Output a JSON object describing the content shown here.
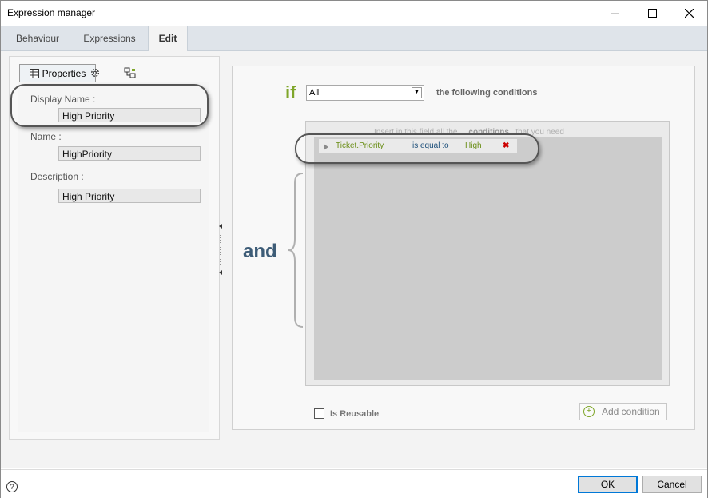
{
  "window": {
    "title": "Expression manager",
    "minimize": "—",
    "maximize": "☐",
    "close": "✕"
  },
  "tabs": [
    {
      "label": "Behaviour"
    },
    {
      "label": "Expressions"
    },
    {
      "label": "Edit"
    }
  ],
  "left_panel": {
    "subtabs": {
      "properties_label": "Properties"
    },
    "fields": {
      "display_name": {
        "label": "Display Name :",
        "value": "High Priority"
      },
      "name": {
        "label": "Name :",
        "value": "HighPriority"
      },
      "description": {
        "label": "Description :",
        "value": "High Priority"
      }
    }
  },
  "rule": {
    "if_label": "if",
    "quantifier": "All",
    "following_label": "the following conditions",
    "hint_prefix": "Insert in this field all the",
    "hint_bold": "conditions",
    "hint_suffix": "that you need",
    "conditions": [
      {
        "field": "Ticket.Priority",
        "operator": "is equal to",
        "value": "High"
      }
    ],
    "and_label": "and",
    "is_reusable_label": "Is Reusable",
    "add_condition_label": "Add condition"
  },
  "footer": {
    "help": "?",
    "ok_label": "OK",
    "cancel_label": "Cancel"
  },
  "colors": {
    "if_green": "#7fa62a",
    "and_blue": "#3d5c77",
    "delete_red": "#cc0000",
    "ok_border": "#0078d7"
  }
}
